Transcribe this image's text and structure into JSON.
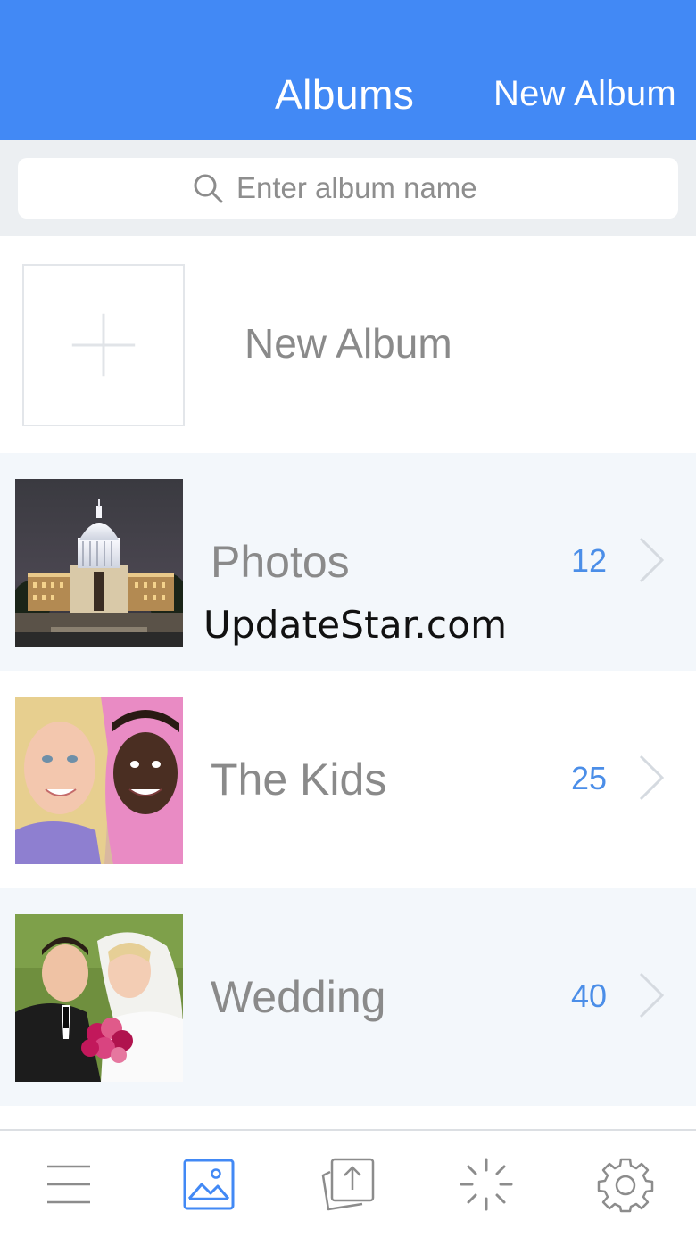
{
  "header": {
    "title": "Albums",
    "new_album_label": "New Album"
  },
  "search": {
    "placeholder": "Enter album name",
    "icon": "search-icon"
  },
  "new_album": {
    "label": "New Album",
    "icon": "plus-icon"
  },
  "albums": [
    {
      "name": "Photos",
      "count": "12",
      "thumbnail": "capitol-building-night"
    },
    {
      "name": "The Kids",
      "count": "25",
      "thumbnail": "two-smiling-girls"
    },
    {
      "name": "Wedding",
      "count": "40",
      "thumbnail": "bride-and-groom-with-roses"
    }
  ],
  "watermark": "UpdateStar.com",
  "tab_bar": {
    "tabs": [
      {
        "icon": "menu-icon",
        "active": false
      },
      {
        "icon": "albums-image-icon",
        "active": true
      },
      {
        "icon": "upload-icon",
        "active": false
      },
      {
        "icon": "loading-spinner-icon",
        "active": false
      },
      {
        "icon": "gear-icon",
        "active": false
      }
    ]
  },
  "colors": {
    "brand_blue": "#4289f5",
    "count_blue": "#4b8ee8",
    "text_gray": "#8a8a8a",
    "icon_gray": "#8c8c8c",
    "row_alt_bg": "#f3f7fb",
    "search_bg": "#eceff2"
  }
}
